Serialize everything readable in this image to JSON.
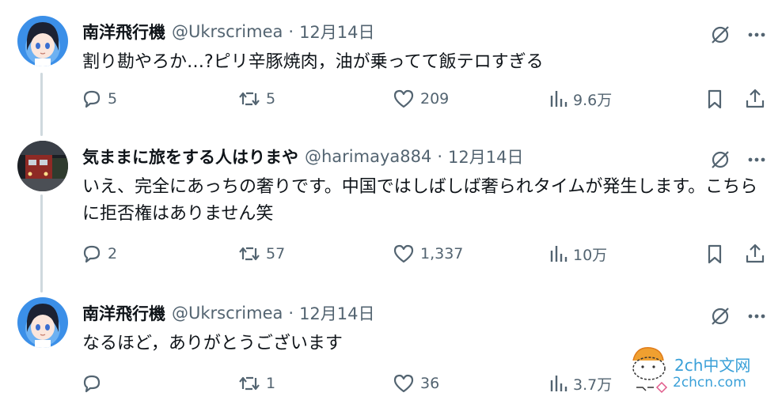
{
  "tweets": [
    {
      "name": "南洋飛行機",
      "handle": "@Ukrscrimea",
      "sep": "·",
      "date": "12月14日",
      "text": "割り勘やろか…?ピリ辛豚焼肉，油が乗ってて飯テロすぎる",
      "replies": "5",
      "retweets": "5",
      "likes": "209",
      "views": "9.6万"
    },
    {
      "name": "気ままに旅をする人はりまや",
      "handle": "@harimaya884",
      "sep": "·",
      "date": "12月14日",
      "text": "いえ、完全にあっちの奢りです。中国ではしばしば奢られタイムが発生します。こちらに拒否権はありません笑",
      "replies": "2",
      "retweets": "57",
      "likes": "1,337",
      "views": "10万"
    },
    {
      "name": "南洋飛行機",
      "handle": "@Ukrscrimea",
      "sep": "·",
      "date": "12月14日",
      "text": "なるほど，ありがとうございます",
      "replies": "",
      "retweets": "1",
      "likes": "36",
      "views": "3.7万"
    }
  ],
  "watermark": {
    "line1": "2ch中文网",
    "line2": "2chcn.com"
  },
  "colors": {
    "text": "#0f1419",
    "secondary": "#536471",
    "thread_line": "#cfd9de",
    "watermark": "#3aa0d8"
  }
}
